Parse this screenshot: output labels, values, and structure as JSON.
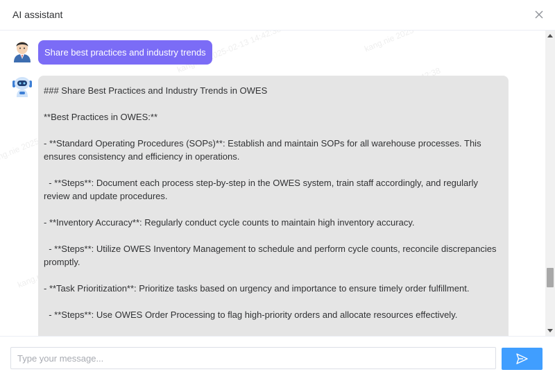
{
  "dialog": {
    "title": "AI assistant",
    "close_icon": "close-icon"
  },
  "conversation": {
    "user_message": "Share best practices and industry trends",
    "ai_message_lines": [
      "### Share Best Practices and Industry Trends in OWES",
      "**Best Practices in OWES:**",
      "- **Standard Operating Procedures (SOPs)**: Establish and maintain SOPs for all warehouse processes. This ensures consistency and efficiency in operations.",
      "  - **Steps**: Document each process step-by-step in the OWES system, train staff accordingly, and regularly review and update procedures.",
      "- **Inventory Accuracy**: Regularly conduct cycle counts to maintain high inventory accuracy.",
      "  - **Steps**: Utilize OWES Inventory Management to schedule and perform cycle counts, reconcile discrepancies promptly.",
      "- **Task Prioritization**: Prioritize tasks based on urgency and importance to ensure timely order fulfillment.",
      "  - **Steps**: Use OWES Order Processing to flag high-priority orders and allocate resources effectively."
    ]
  },
  "composer": {
    "placeholder": "Type your message...",
    "value": "",
    "send_icon": "send-icon"
  },
  "watermark": {
    "text": "kang.nie 2025-02-13 14:42:38"
  },
  "colors": {
    "user_bubble": "#7b6cf6",
    "ai_bubble": "#e5e5e5",
    "send_button": "#409eff"
  }
}
